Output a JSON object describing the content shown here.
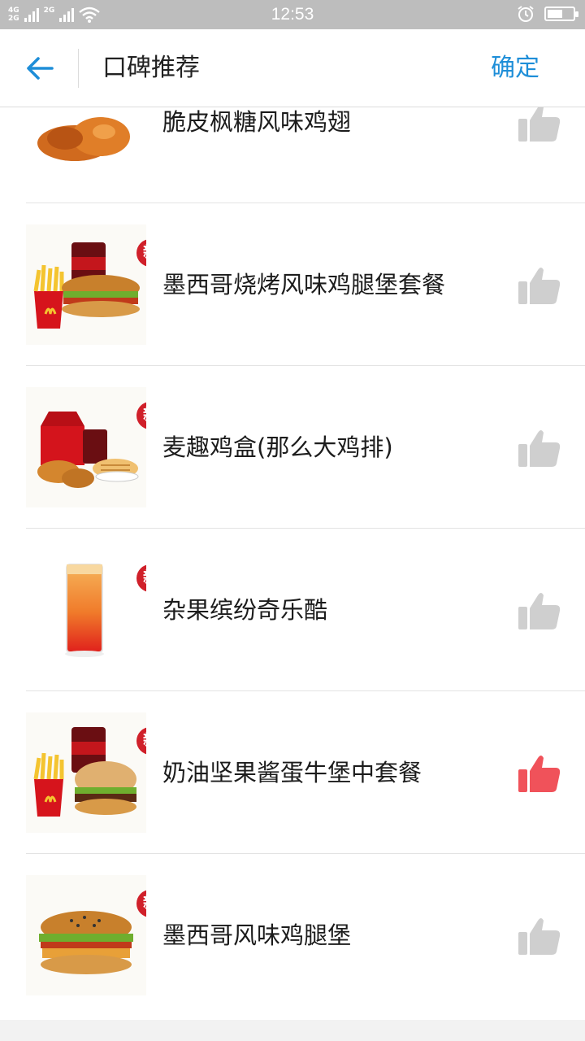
{
  "status_bar": {
    "net_top": "4G",
    "net_bottom": "2G",
    "net2": "2G",
    "time": "12:53",
    "battery_level": 0.6
  },
  "header": {
    "title": "口碑推荐",
    "confirm_label": "确定"
  },
  "colors": {
    "accent": "#1e8ed8",
    "liked": "#f0525a",
    "unliked": "#cfcfcf",
    "badge": "#d0202a"
  },
  "items": [
    {
      "name": "脆皮枫糖风味鸡翅",
      "is_new": false,
      "liked": false,
      "icon": "chicken-wings-image"
    },
    {
      "name": "墨西哥烧烤风味鸡腿堡套餐",
      "is_new": true,
      "badge": "新",
      "liked": false,
      "icon": "burger-meal-image"
    },
    {
      "name": "麦趣鸡盒(那么大鸡排)",
      "is_new": true,
      "badge": "新",
      "liked": false,
      "icon": "chicken-box-image"
    },
    {
      "name": "杂果缤纷奇乐酷",
      "is_new": true,
      "badge": "新",
      "liked": false,
      "icon": "fruit-drink-image"
    },
    {
      "name": "奶油坚果酱蛋牛堡中套餐",
      "is_new": true,
      "badge": "新",
      "liked": true,
      "icon": "beef-burger-meal-image"
    },
    {
      "name": "墨西哥风味鸡腿堡",
      "is_new": true,
      "badge": "新",
      "liked": false,
      "icon": "chicken-burger-image"
    }
  ]
}
